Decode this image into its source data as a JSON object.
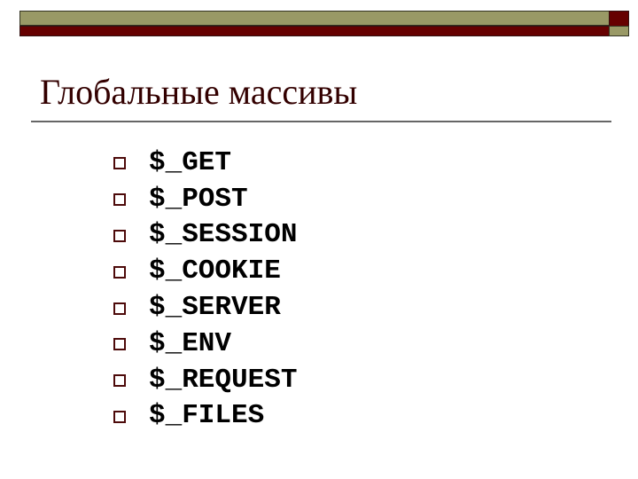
{
  "slide": {
    "title": "Глобальные массивы",
    "items": [
      {
        "label": "$_GET"
      },
      {
        "label": "$_POST"
      },
      {
        "label": "$_SESSION"
      },
      {
        "label": "$_COOKIE"
      },
      {
        "label": "$_SERVER"
      },
      {
        "label": "$_ENV"
      },
      {
        "label": "$_REQUEST"
      },
      {
        "label": "$_FILES"
      }
    ],
    "bullet_icon": "hollow-square",
    "colors": {
      "olive": "#999966",
      "maroon": "#660000",
      "title": "#330000",
      "rule": "#666666",
      "text": "#000000"
    }
  }
}
